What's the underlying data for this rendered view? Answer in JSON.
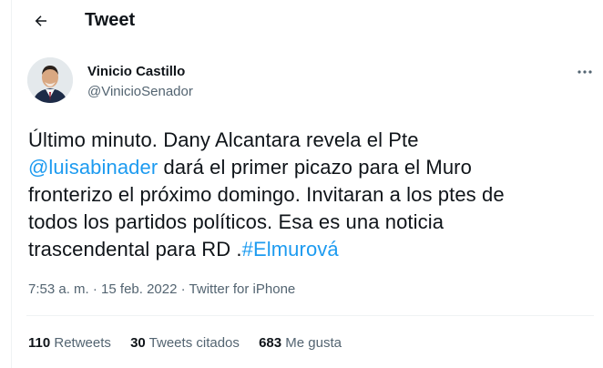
{
  "header": {
    "back_icon": "arrow-left-icon",
    "title": "Tweet"
  },
  "author": {
    "name": "Vinicio Castillo",
    "handle": "@VinicioSenador",
    "more_icon": "more-horizontal-icon"
  },
  "tweet": {
    "line1": "Último minuto. Dany Alcantara revela el Pte",
    "mention": "@luisabinader",
    "line2_rest": " dará el primer picazo para el Muro",
    "line3": "fronterizo el próximo domingo. Invitaran a los ptes de",
    "line4": "todos los partidos políticos. Esa es una noticia",
    "line5_start": "trascendental para RD .",
    "hashtag": "#Elmurová"
  },
  "meta": {
    "time": "7:53 a. m.",
    "sep1": " · ",
    "date": "15 feb. 2022",
    "sep2": " · ",
    "source": "Twitter for iPhone"
  },
  "stats": {
    "retweets_count": "110",
    "retweets_label": "Retweets",
    "quotes_count": "30",
    "quotes_label": "Tweets citados",
    "likes_count": "683",
    "likes_label": "Me gusta"
  },
  "colors": {
    "link": "#1d9bf0",
    "text": "#0f1419",
    "secondary": "#536471",
    "divider": "#eff3f4"
  }
}
